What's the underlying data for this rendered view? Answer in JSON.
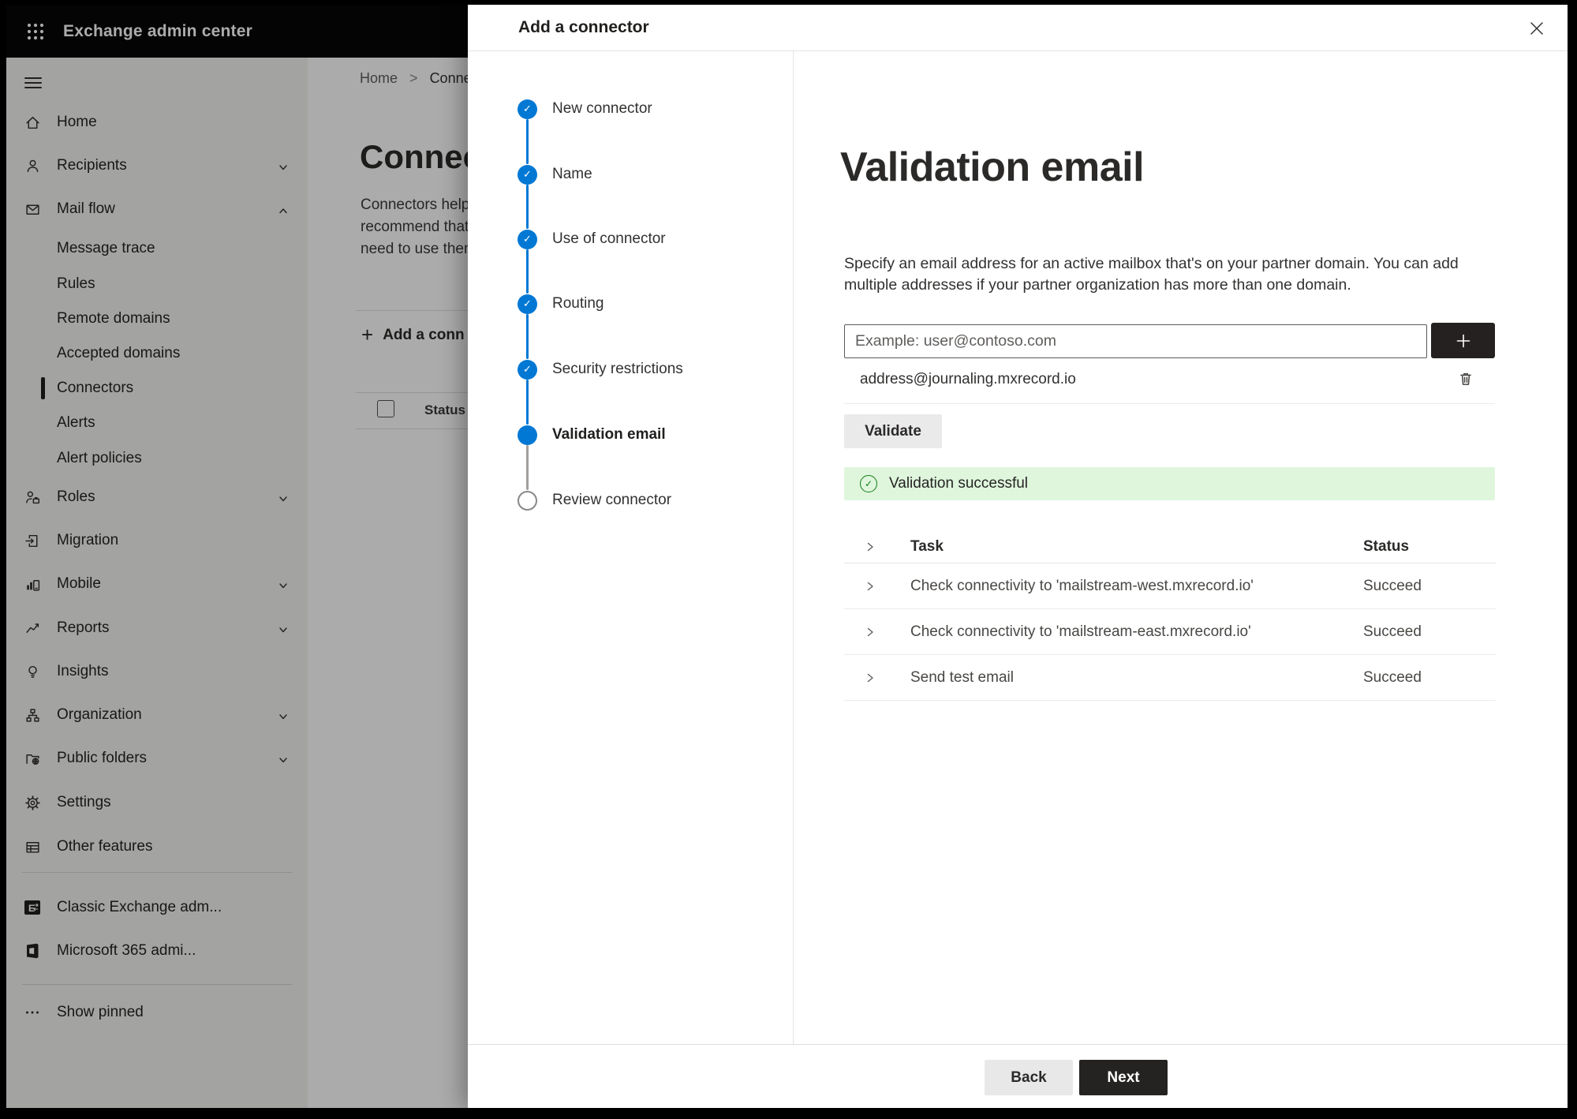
{
  "topbar": {
    "title": "Exchange admin center"
  },
  "sidebar": {
    "items": [
      {
        "label": "Home"
      },
      {
        "label": "Recipients"
      },
      {
        "label": "Mail flow"
      },
      {
        "label": "Message trace"
      },
      {
        "label": "Rules"
      },
      {
        "label": "Remote domains"
      },
      {
        "label": "Accepted domains"
      },
      {
        "label": "Connectors",
        "selected": true
      },
      {
        "label": "Alerts"
      },
      {
        "label": "Alert policies"
      },
      {
        "label": "Roles"
      },
      {
        "label": "Migration"
      },
      {
        "label": "Mobile"
      },
      {
        "label": "Reports"
      },
      {
        "label": "Insights"
      },
      {
        "label": "Organization"
      },
      {
        "label": "Public folders"
      },
      {
        "label": "Settings"
      },
      {
        "label": "Other features"
      },
      {
        "label": "Classic Exchange adm..."
      },
      {
        "label": "Microsoft 365 admi..."
      },
      {
        "label": "Show pinned"
      }
    ]
  },
  "page": {
    "breadcrumb_home": "Home",
    "breadcrumb_separator": ">",
    "breadcrumb_current": "Conne",
    "title": "Connect",
    "intro_lines": [
      "Connectors help",
      "recommend that",
      "need to use them"
    ],
    "add_connector_label": "Add a conn",
    "list_header_status": "Status"
  },
  "dialog": {
    "title": "Add a connector",
    "steps": [
      {
        "label": "New connector",
        "state": "complete"
      },
      {
        "label": "Name",
        "state": "complete"
      },
      {
        "label": "Use of connector",
        "state": "complete"
      },
      {
        "label": "Routing",
        "state": "complete"
      },
      {
        "label": "Security restrictions",
        "state": "complete"
      },
      {
        "label": "Validation email",
        "state": "current"
      },
      {
        "label": "Review connector",
        "state": "pending"
      }
    ],
    "heading": "Validation email",
    "description": "Specify an email address for an active mailbox that's on your partner domain. You can add multiple addresses if your partner organization has more than one domain.",
    "email_input": {
      "value": "",
      "placeholder": "Example: user@contoso.com"
    },
    "added_address": "address@journaling.mxrecord.io",
    "validate_button": "Validate",
    "success_message": "Validation successful",
    "check_glyph": "✓",
    "table": {
      "col_task": "Task",
      "col_status": "Status",
      "rows": [
        {
          "task": "Check connectivity to 'mailstream-west.mxrecord.io'",
          "status": "Succeed"
        },
        {
          "task": "Check connectivity to 'mailstream-east.mxrecord.io'",
          "status": "Succeed"
        },
        {
          "task": "Send test email",
          "status": "Succeed"
        }
      ]
    },
    "footer": {
      "back": "Back",
      "next": "Next"
    }
  },
  "colors": {
    "accent_blue": "#0078d4",
    "success_background": "#dff6dd",
    "success_green": "#107c10",
    "primary_button": "#242322"
  }
}
